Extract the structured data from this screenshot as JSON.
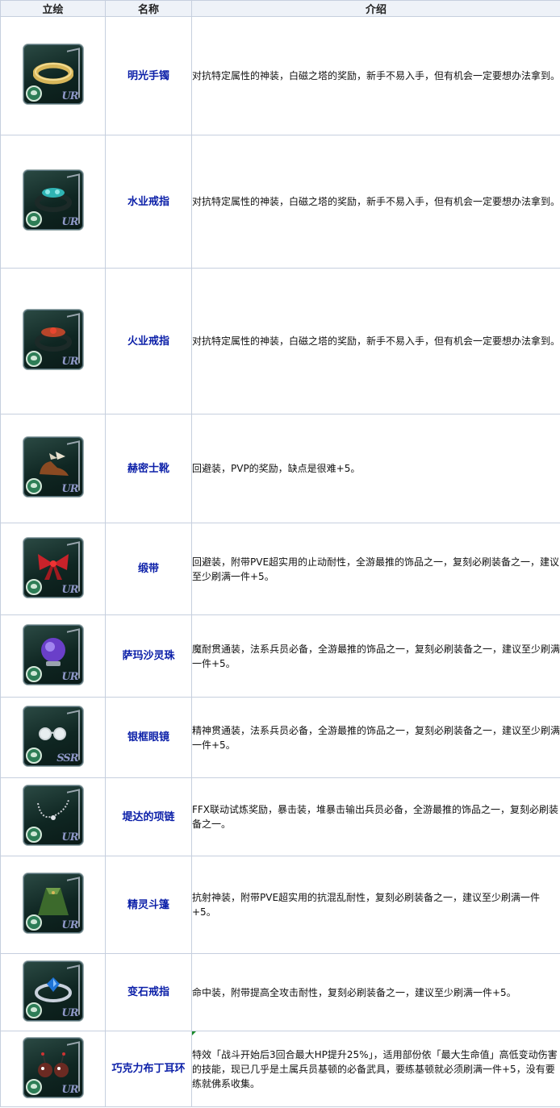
{
  "headers": {
    "col1": "立绘",
    "col2": "名称",
    "col3": "介绍"
  },
  "rows": [
    {
      "icon": "gold-bracelet-icon",
      "rank": "UR",
      "name": "明光手镯",
      "desc": "对抗特定属性的神装，白磁之塔的奖励，新手不易入手，但有机会一定要想办法拿到。"
    },
    {
      "icon": "blue-gem-ring-icon",
      "rank": "UR",
      "name": "水业戒指",
      "desc": "对抗特定属性的神装，白磁之塔的奖励，新手不易入手，但有机会一定要想办法拿到。"
    },
    {
      "icon": "red-gem-ring-icon",
      "rank": "UR",
      "name": "火业戒指",
      "desc": "对抗特定属性的神装，白磁之塔的奖励，新手不易入手，但有机会一定要想办法拿到。"
    },
    {
      "icon": "winged-boots-icon",
      "rank": "UR",
      "name": "赫密士靴",
      "desc": "回避装，PVP的奖励，缺点是很难+5。"
    },
    {
      "icon": "red-ribbon-icon",
      "rank": "UR",
      "name": "缎带",
      "desc": "回避装，附带PVE超实用的止动耐性，全游最推的饰品之一，复刻必刷装备之一，建议至少刷满一件+5。"
    },
    {
      "icon": "crystal-orb-icon",
      "rank": "UR",
      "name": "萨玛沙灵珠",
      "desc": "魔耐贯通装，法系兵员必备，全游最推的饰品之一，复刻必刷装备之一，建议至少刷满一件+5。"
    },
    {
      "icon": "glasses-icon",
      "rank": "SSR",
      "name": "银框眼镜",
      "desc": "精神贯通装，法系兵员必备，全游最推的饰品之一，复刻必刷装备之一，建议至少刷满一件+5。"
    },
    {
      "icon": "necklace-icon",
      "rank": "UR",
      "name": "堤达的项链",
      "desc": "FFX联动试炼奖励，暴击装，堆暴击输出兵员必备，全游最推的饰品之一，复刻必刷装备之一。"
    },
    {
      "icon": "green-cloak-icon",
      "rank": "UR",
      "name": "精灵斗篷",
      "desc": "抗射神装，附带PVE超实用的抗混乱耐性，复刻必刷装备之一，建议至少刷满一件+5。"
    },
    {
      "icon": "blue-stone-ring-icon",
      "rank": "UR",
      "name": "变石戒指",
      "desc": "命中装，附带提高全攻击耐性，复刻必刷装备之一，建议至少刷满一件+5。"
    },
    {
      "icon": "chocolate-pudding-earring-icon",
      "rank": "UR",
      "name": "巧克力布丁耳环",
      "desc": "特效「战斗开始后3回合最大HP提升25%」，适用部份依「最大生命值」高低变动伤害的技能，现已几乎是土属兵员基顿的必备武具，要练基顿就必须刷满一件+5，没有要练就佛系收集。"
    }
  ],
  "colors": {
    "name_text": "#0b1fa8",
    "border": "#c6cfde",
    "header_bg": "#eef2f8"
  }
}
